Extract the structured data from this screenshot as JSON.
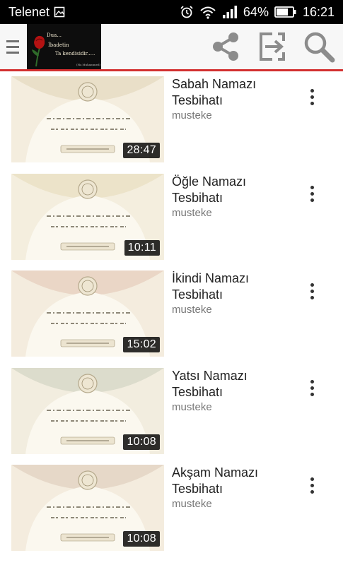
{
  "status_bar": {
    "carrier": "Telenet",
    "battery_percent": "64%",
    "time": "16:21",
    "icons": [
      "image-icon",
      "alarm-icon",
      "wifi-icon",
      "signal-icon",
      "battery-icon"
    ]
  },
  "toolbar": {
    "logo": {
      "line1": "Dua...",
      "line2": "İbadetin",
      "line3": "Ta kendisidir.....",
      "line4": "(Hz.Muhammed)"
    },
    "actions": [
      "share-icon",
      "exit-icon",
      "search-icon"
    ],
    "accent_color": "#d32f2f"
  },
  "videos": [
    {
      "title": "Sabah Namazı Tesbihatı",
      "channel": "musteke",
      "duration": "28:47",
      "theme": "#e9dfc8"
    },
    {
      "title": "Öğle Namazı Tesbihatı",
      "channel": "musteke",
      "duration": "10:11",
      "theme": "#ece3c9"
    },
    {
      "title": "İkindi Namazı Tesbihatı",
      "channel": "musteke",
      "duration": "15:02",
      "theme": "#ead6c6"
    },
    {
      "title": "Yatsı Namazı Tesbihatı",
      "channel": "musteke",
      "duration": "10:08",
      "theme": "#dcdccc"
    },
    {
      "title": "Akşam Namazı Tesbihatı",
      "channel": "musteke",
      "duration": "10:08",
      "theme": "#e6d8c8"
    }
  ]
}
